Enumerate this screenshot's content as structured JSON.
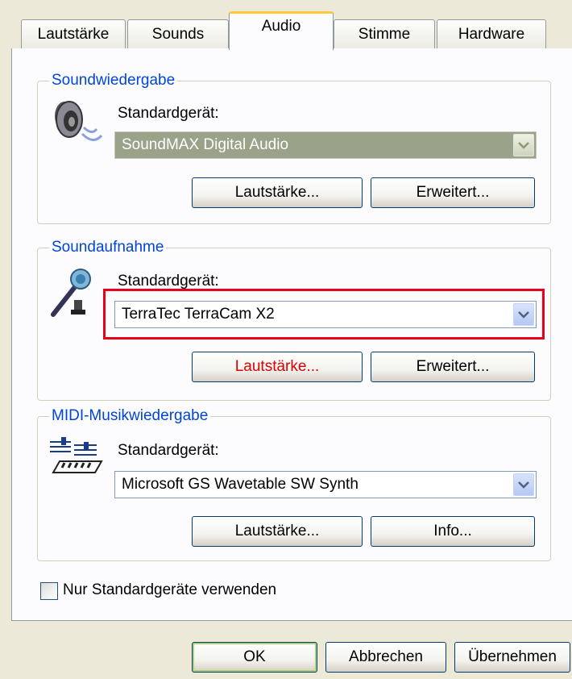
{
  "tabs": [
    {
      "label": "Lautstärke"
    },
    {
      "label": "Sounds"
    },
    {
      "label": "Audio"
    },
    {
      "label": "Stimme"
    },
    {
      "label": "Hardware"
    }
  ],
  "active_tab": "Audio",
  "playback": {
    "legend": "Soundwiedergabe",
    "device_label": "Standardgerät:",
    "device_value": "SoundMAX Digital Audio",
    "device_state": "disabled",
    "volume_button": "Lautstärke...",
    "advanced_button": "Erweitert..."
  },
  "recording": {
    "legend": "Soundaufnahme",
    "device_label": "Standardgerät:",
    "device_value": "TerraTec TerraCam X2",
    "volume_button": "Lautstärke...",
    "advanced_button": "Erweitert..."
  },
  "midi": {
    "legend": "MIDI-Musikwiedergabe",
    "device_label": "Standardgerät:",
    "device_value": "Microsoft GS Wavetable SW Synth",
    "volume_button": "Lautstärke...",
    "info_button": "Info..."
  },
  "default_only_checkbox": {
    "label": "Nur Standardgeräte verwenden",
    "checked": false
  },
  "footer": {
    "ok": "OK",
    "cancel": "Abbrechen",
    "apply": "Übernehmen"
  },
  "colors": {
    "highlight": "#e8001c",
    "legend_text": "#0046d5",
    "active_tab_accent": "#ffc83c"
  }
}
